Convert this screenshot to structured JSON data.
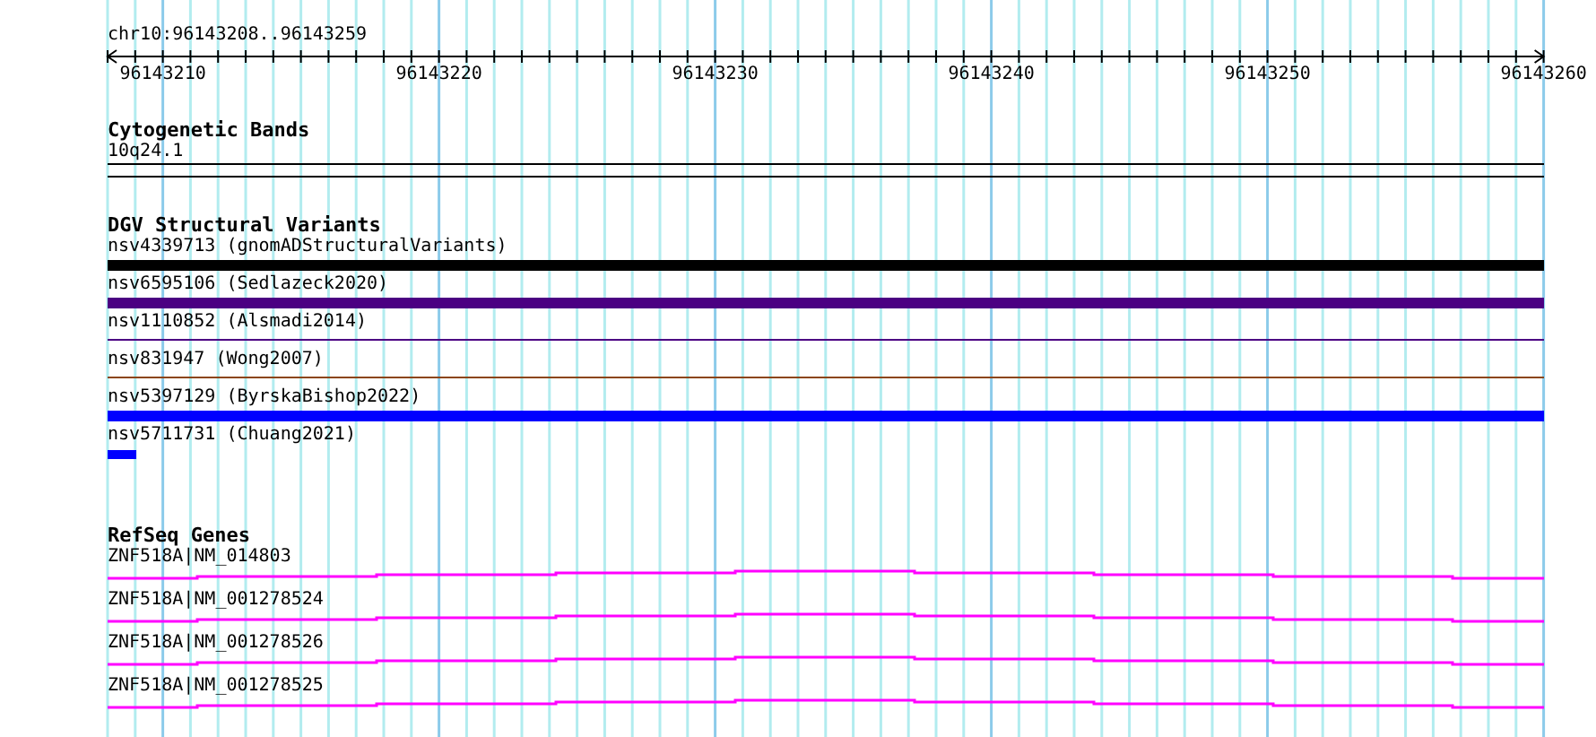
{
  "ruler": {
    "location": "chr10:96143208..96143259",
    "ticks": [
      "96143210",
      "96143220",
      "96143230",
      "96143240",
      "96143250",
      "96143260"
    ]
  },
  "tracks": [
    {
      "kind": "bands",
      "title": "Cytogenetic Bands",
      "features": [
        {
          "label": "10q24.1"
        }
      ]
    },
    {
      "kind": "variants",
      "title": "DGV Structural Variants",
      "features": [
        {
          "label": "nsv4339713 (gnomADStructuralVariants)",
          "kind": "thick",
          "color": "#000000"
        },
        {
          "label": "nsv6595106 (Sedlazeck2020)",
          "kind": "thick",
          "color": "#4b0082"
        },
        {
          "label": "nsv1110852 (Alsmadi2014)",
          "kind": "thin",
          "color": "#4b0082"
        },
        {
          "label": "nsv831947 (Wong2007)",
          "kind": "thin",
          "color": "#8b4513"
        },
        {
          "label": "nsv5397129 (ByrskaBishop2022)",
          "kind": "thick",
          "color": "#0000ff"
        },
        {
          "label": "nsv5711731 (Chuang2021)",
          "kind": "short",
          "color": "#0000ff"
        }
      ]
    },
    {
      "kind": "genes",
      "title": "RefSeq Genes",
      "features": [
        {
          "label": "ZNF518A|NM_014803"
        },
        {
          "label": "ZNF518A|NM_001278524"
        },
        {
          "label": "ZNF518A|NM_001278526"
        },
        {
          "label": "ZNF518A|NM_001278525"
        }
      ]
    }
  ]
}
